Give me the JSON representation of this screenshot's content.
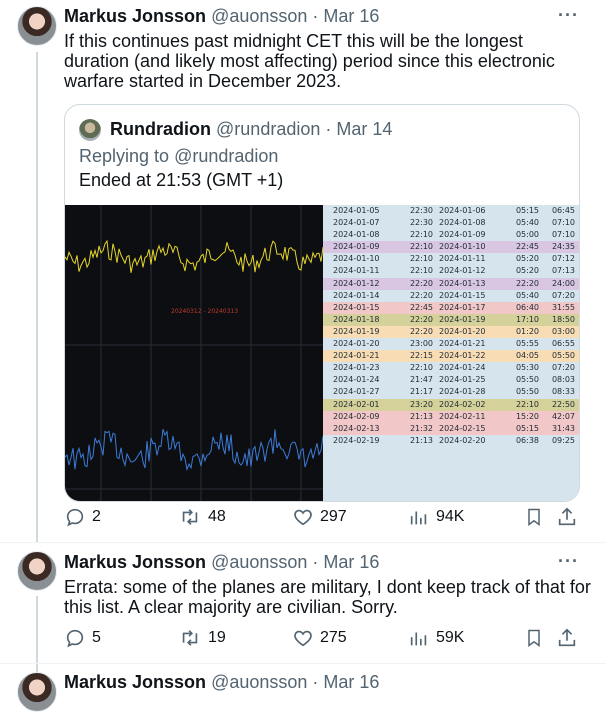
{
  "tweets": [
    {
      "name": "Markus Jonsson",
      "handle": "@auonsson",
      "sep": " · ",
      "date": "Mar 16",
      "text": "If this continues past midnight CET this will be the longest duration (and likely most affecting) period since this electronic warfare started in December 2023.",
      "replies": "2",
      "retweets": "48",
      "likes": "297",
      "views": "94K"
    },
    {
      "name": "Markus Jonsson",
      "handle": "@auonsson",
      "sep": " · ",
      "date": "Mar 16",
      "text": "Errata: some of the planes are military, I dont keep track of that for this list. A clear majority are civilian. Sorry.",
      "replies": "5",
      "retweets": "19",
      "likes": "275",
      "views": "59K"
    },
    {
      "name": "Markus Jonsson",
      "handle": "@auonsson",
      "sep": " · ",
      "date": "Mar 16"
    }
  ],
  "quote": {
    "name": "Rundradion",
    "handle": "@rundradion",
    "sep": " · ",
    "date": "Mar 14",
    "reply_prefix": "Replying to ",
    "reply_handle": "@rundradion",
    "text": "Ended at 21:53 (GMT +1)"
  },
  "media": {
    "chart_label": "20240312 - 20240313",
    "rows": [
      [
        "2024-01-05",
        "22:30",
        "2024-01-06",
        "05:15",
        "06:45",
        "#d6e4ee"
      ],
      [
        "2024-01-07",
        "22:30",
        "2024-01-08",
        "05:40",
        "07:10",
        "#d6e4ee"
      ],
      [
        "2024-01-08",
        "22:10",
        "2024-01-09",
        "05:00",
        "07:10",
        "#d6e4ee"
      ],
      [
        "2024-01-09",
        "22:10",
        "2024-01-10",
        "22:45",
        "24:35",
        "#d9c6e3"
      ],
      [
        "2024-01-10",
        "22:10",
        "2024-01-11",
        "05:20",
        "07:12",
        "#d6e4ee"
      ],
      [
        "2024-01-11",
        "22:10",
        "2024-01-12",
        "05:20",
        "07:13",
        "#d6e4ee"
      ],
      [
        "2024-01-12",
        "22:20",
        "2024-01-13",
        "22:20",
        "24:00",
        "#d9c6e3"
      ],
      [
        "2024-01-14",
        "22:20",
        "2024-01-15",
        "05:40",
        "07:20",
        "#d6e4ee"
      ],
      [
        "2024-01-15",
        "22:45",
        "2024-01-17",
        "06:40",
        "31:55",
        "#f2c7c7"
      ],
      [
        "2024-01-18",
        "22:20",
        "2024-01-19",
        "17:10",
        "18:50",
        "#d5d19a"
      ],
      [
        "2024-01-19",
        "22:20",
        "2024-01-20",
        "01:20",
        "03:00",
        "#f8dcb4"
      ],
      [
        "2024-01-20",
        "23:00",
        "2024-01-21",
        "05:55",
        "06:55",
        "#d6e4ee"
      ],
      [
        "2024-01-21",
        "22:15",
        "2024-01-22",
        "04:05",
        "05:50",
        "#f8dcb4"
      ],
      [
        "2024-01-23",
        "22:10",
        "2024-01-24",
        "05:30",
        "07:20",
        "#d6e4ee"
      ],
      [
        "2024-01-24",
        "21:47",
        "2024-01-25",
        "05:50",
        "08:03",
        "#d6e4ee"
      ],
      [
        "2024-01-27",
        "21:17",
        "2024-01-28",
        "05:50",
        "08:33",
        "#d6e4ee"
      ],
      [
        "2024-02-01",
        "23:20",
        "2024-02-02",
        "22:10",
        "22:50",
        "#d5d19a"
      ],
      [
        "2024-02-09",
        "21:13",
        "2024-02-11",
        "15:20",
        "42:07",
        "#f2c7c7"
      ],
      [
        "2024-02-13",
        "21:32",
        "2024-02-15",
        "05:15",
        "31:43",
        "#f2c7c7"
      ],
      [
        "2024-02-19",
        "21:13",
        "2024-02-20",
        "06:38",
        "09:25",
        "#d6e4ee"
      ]
    ]
  },
  "colors": {
    "text": "#0f1419",
    "muted": "#536471",
    "border": "#cfd9de",
    "chart_yellow": "#e6d52a",
    "chart_blue": "#3d7bd6",
    "chart_label": "#c0392b"
  },
  "icons": [
    "reply-icon",
    "retweet-icon",
    "like-icon",
    "views-icon",
    "bookmark-icon",
    "share-icon",
    "more-icon"
  ]
}
